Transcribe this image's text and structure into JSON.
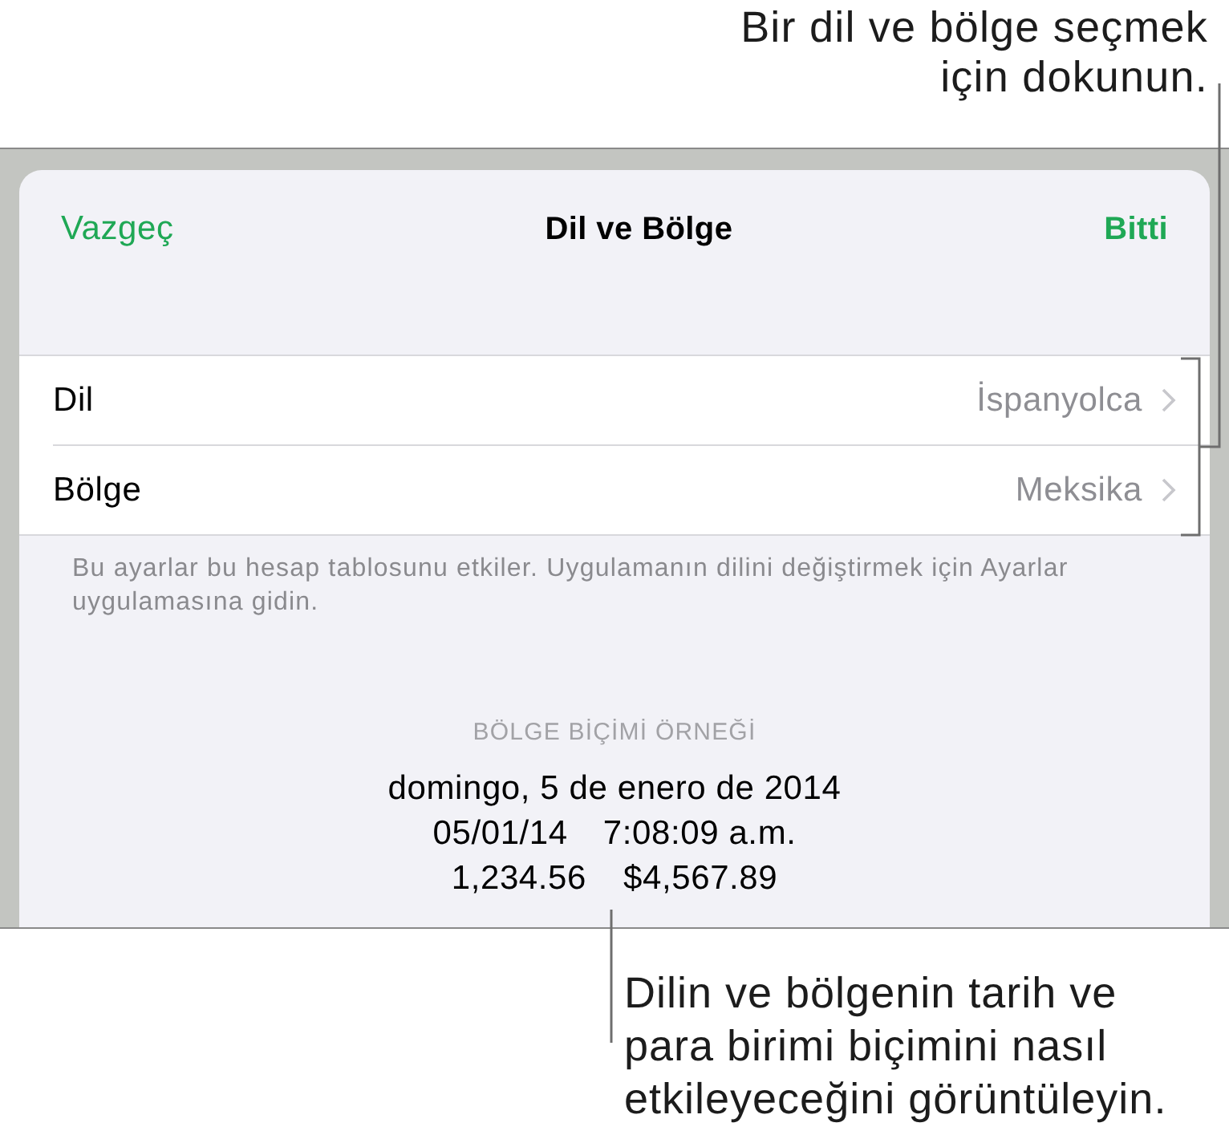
{
  "top_callout": "Bir dil ve bölge seçmek için dokunun.",
  "sheet": {
    "nav": {
      "cancel": "Vazgeç",
      "title": "Dil ve Bölge",
      "done": "Bitti"
    },
    "rows": [
      {
        "label": "Dil",
        "value": "İspanyolca"
      },
      {
        "label": "Bölge",
        "value": "Meksika"
      }
    ],
    "footnote": "Bu ayarlar bu hesap tablosunu etkiler. Uygulamanın dilini değiştirmek için Ayarlar uygulamasına gidin.",
    "sample": {
      "heading": "BÖLGE BİÇİMİ ÖRNEĞİ",
      "date": "domingo, 5 de enero de 2014",
      "short_date": "05/01/14",
      "time": "7:08:09 a.m.",
      "number": "1,234.56",
      "currency": "$4,567.89"
    }
  },
  "bottom_callout": "Dilin ve bölgenin tarih ve para birimi biçimini nasıl etkileyeceğini görüntüleyin."
}
